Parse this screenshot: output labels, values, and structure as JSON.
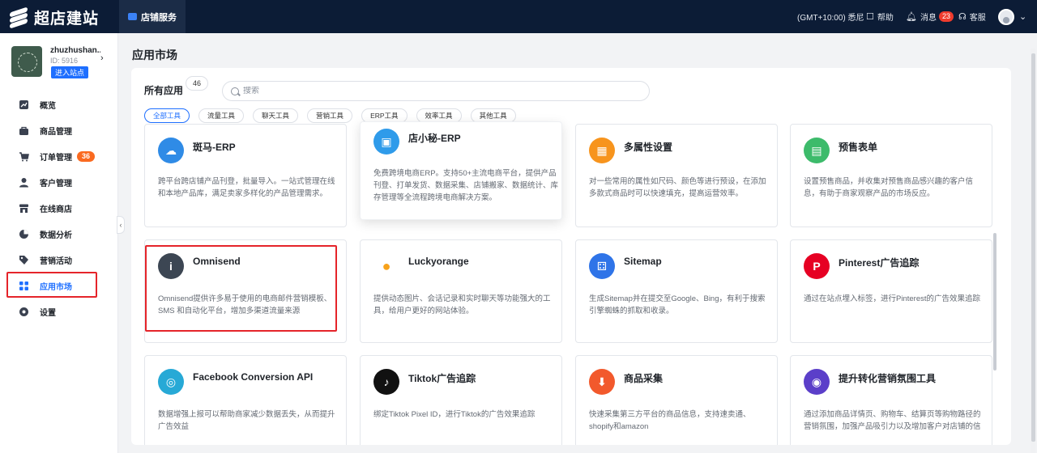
{
  "app": {
    "logo_text": "超店建站"
  },
  "topnav": {
    "active_tab": "店铺服务",
    "timezone": "(GMT+10:00) 悉尼",
    "help": "帮助",
    "messages": "消息",
    "messages_count": "23",
    "service": "客服",
    "avatar_chevron": "⌄"
  },
  "store": {
    "name": "zhuzhushan...",
    "id": "ID: 5916",
    "enter_btn": "进入站点",
    "chevron": "›"
  },
  "sidebar": {
    "items": [
      {
        "label": "概览",
        "icon": "chart-icon"
      },
      {
        "label": "商品管理",
        "icon": "bag-icon"
      },
      {
        "label": "订单管理",
        "icon": "cart-icon",
        "badge": "36"
      },
      {
        "label": "客户管理",
        "icon": "user-icon"
      },
      {
        "label": "在线商店",
        "icon": "store-icon"
      },
      {
        "label": "数据分析",
        "icon": "pie-icon"
      },
      {
        "label": "营销活动",
        "icon": "tag-icon"
      },
      {
        "label": "应用市场",
        "icon": "grid-icon",
        "active": true
      },
      {
        "label": "设置",
        "icon": "gear-icon"
      }
    ],
    "collapse": "‹"
  },
  "page": {
    "title": "应用市场"
  },
  "apps_panel": {
    "title": "所有应用",
    "count": "46",
    "search_placeholder": "搜索",
    "filters": [
      "全部工具",
      "流量工具",
      "聊天工具",
      "营销工具",
      "ERP工具",
      "效率工具",
      "其他工具"
    ],
    "cards": [
      {
        "title": "斑马-ERP",
        "desc": "跨平台跨店铺产品刊登，批量导入。一站式管理在线和本地产品库，满足卖家多样化的产品管理需求。",
        "color": "#2f8be6",
        "glyph": "☁"
      },
      {
        "title": "店小秘-ERP",
        "desc": "免费跨境电商ERP。支持50+主流电商平台，提供产品刊登、打单发货、数据采集、店铺搬家、数据统计、库存管理等全流程跨境电商解决方案。",
        "color": "#2f9bea",
        "glyph": "▣"
      },
      {
        "title": "多属性设置",
        "desc": "对一些常用的属性如尺码、颜色等进行预设，在添加多款式商品时可以快速填充，提高运营效率。",
        "color": "#f7941d",
        "glyph": "▦"
      },
      {
        "title": "预售表单",
        "desc": "设置预售商品，并收集对预售商品感兴趣的客户信息，有助于商家观察产品的市场反应。",
        "color": "#3dbb6b",
        "glyph": "▤"
      },
      {
        "title": "Omnisend",
        "desc": "Omnisend提供许多易于使用的电商邮件营销模板、SMS 和自动化平台，增加多渠道流量来源",
        "color": "#3c4653",
        "glyph": "i"
      },
      {
        "title": "Luckyorange",
        "desc": "提供动态图片、会话记录和实时聊天等功能强大的工具，给用户更好的网站体验。",
        "color": "#ffffff",
        "glyph": "●"
      },
      {
        "title": "Sitemap",
        "desc": "生成Sitemap并在提交至Google、Bing，有利于搜索引擎蜘蛛的抓取和收录。",
        "color": "#2f74e8",
        "glyph": "⚃"
      },
      {
        "title": "Pinterest广告追踪",
        "desc": "通过在站点埋入标签，进行Pinterest的广告效果追踪",
        "color": "#e60023",
        "glyph": "P"
      },
      {
        "title": "Facebook Conversion API",
        "desc": "数据增强上报可以帮助商家减少数据丢失，从而提升广告效益",
        "color": "#27a9d6",
        "glyph": "◎"
      },
      {
        "title": "Tiktok广告追踪",
        "desc": "绑定Tiktok Pixel ID，进行Tiktok的广告效果追踪",
        "color": "#111111",
        "glyph": "♪"
      },
      {
        "title": "商品采集",
        "desc": "快速采集第三方平台的商品信息，支持速卖通、shopify和amazon",
        "color": "#f2592c",
        "glyph": "⬇"
      },
      {
        "title": "提升转化营销氛围工具",
        "desc": "通过添加商品详情页、购物车、结算页等购物路径的营销氛围，加强产品吸引力以及增加客户对店铺的信",
        "color": "#5b3fc9",
        "glyph": "◉"
      }
    ]
  }
}
